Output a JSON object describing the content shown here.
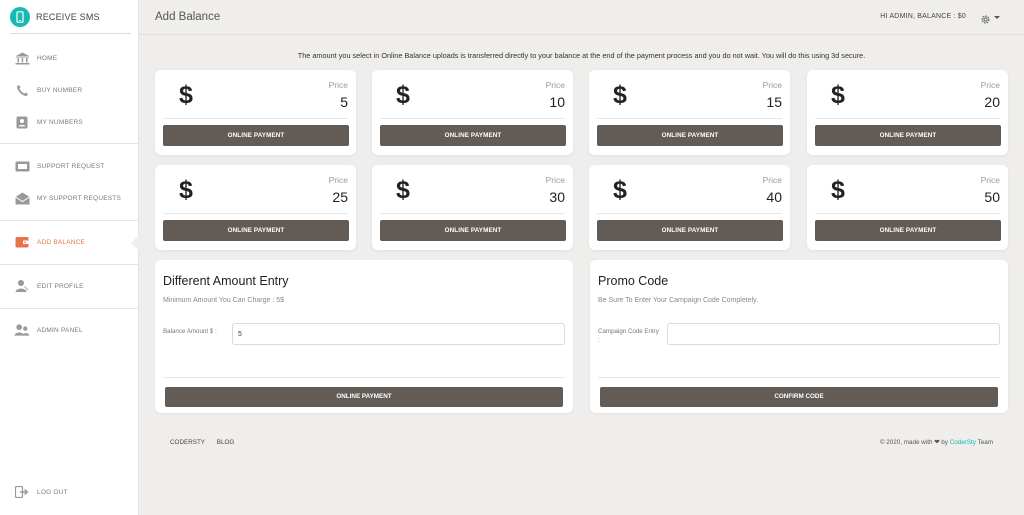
{
  "brand": {
    "name": "RECEIVE SMS"
  },
  "sidebar": {
    "items": [
      {
        "label": "HOME",
        "icon": "bank-icon"
      },
      {
        "label": "BUY NUMBER",
        "icon": "phone-icon"
      },
      {
        "label": "MY NUMBERS",
        "icon": "contact-card-icon"
      },
      {
        "label": "SUPPORT REQUEST",
        "icon": "ticket-icon"
      },
      {
        "label": "MY SUPPORT REQUESTS",
        "icon": "envelope-open-icon"
      },
      {
        "label": "ADD BALANCE",
        "icon": "wallet-icon",
        "active": true
      },
      {
        "label": "EDIT PROFILE",
        "icon": "user-edit-icon"
      },
      {
        "label": "ADMIN PANEL",
        "icon": "users-icon"
      }
    ],
    "logout": {
      "label": "LOG OUT",
      "icon": "sign-out-icon"
    }
  },
  "header": {
    "title": "Add Balance",
    "user_info": "HI ADMIN, BALANCE : $0",
    "settings_icon": "gear-icon"
  },
  "notice": "The amount you select in Online Balance uploads is transferred directly to your balance at the end of the payment process and you do not wait. You will do this using 3d secure.",
  "price_cards": [
    {
      "currency": "$",
      "label": "Price",
      "value": "5",
      "button": "ONLINE PAYMENT"
    },
    {
      "currency": "$",
      "label": "Price",
      "value": "10",
      "button": "ONLINE PAYMENT"
    },
    {
      "currency": "$",
      "label": "Price",
      "value": "15",
      "button": "ONLINE PAYMENT"
    },
    {
      "currency": "$",
      "label": "Price",
      "value": "20",
      "button": "ONLINE PAYMENT"
    },
    {
      "currency": "$",
      "label": "Price",
      "value": "25",
      "button": "ONLINE PAYMENT"
    },
    {
      "currency": "$",
      "label": "Price",
      "value": "30",
      "button": "ONLINE PAYMENT"
    },
    {
      "currency": "$",
      "label": "Price",
      "value": "40",
      "button": "ONLINE PAYMENT"
    },
    {
      "currency": "$",
      "label": "Price",
      "value": "50",
      "button": "ONLINE PAYMENT"
    }
  ],
  "different_amount": {
    "title": "Different Amount Entry",
    "subtitle": "Minimum Amount You Can Charge : 5$",
    "field_label": "Balance Amount $ :",
    "field_value": "5",
    "button": "ONLINE PAYMENT"
  },
  "promo": {
    "title": "Promo Code",
    "subtitle": "Be Sure To Enter Your Campaign Code Completely.",
    "field_label": "Campaign Code Entry :",
    "field_value": "",
    "button": "CONFIRM CODE"
  },
  "footer": {
    "links": [
      "CODERSTY",
      "BLOG"
    ],
    "credit_prefix": "© 2020, made with",
    "credit_by": "by",
    "credit_link": "CoderSty",
    "credit_suffix": "Team",
    "heart_icon": "heart-icon"
  },
  "colors": {
    "accent": "#e8744b",
    "brand": "#17b9b0",
    "button": "#635c56",
    "background": "#efeeec"
  }
}
